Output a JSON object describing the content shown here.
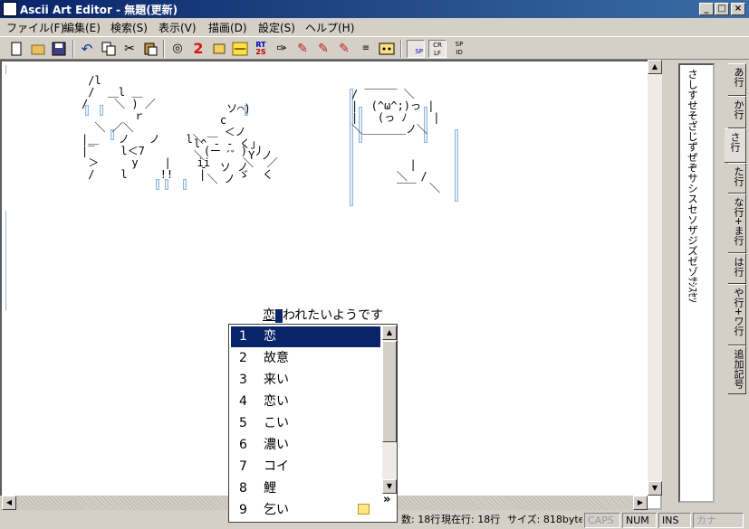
{
  "window": {
    "title": "Ascii Art Editor - 無題(更新)",
    "controls": [
      "_",
      "□",
      "×"
    ]
  },
  "menu": [
    "ファイル(F)",
    "編集(E)",
    "検索(S)",
    "表示(V)",
    "描画(D)",
    "設定(S)",
    "ヘルプ(H)"
  ],
  "toolbar": {
    "icons": [
      "new-file-icon",
      "open-folder-icon",
      "save-icon",
      "undo-icon",
      "copy-icon",
      "cut-icon",
      "paste-icon",
      "find-icon",
      "number-two-icon",
      "replace-icon",
      "line-icon",
      "rt-to-icon",
      "shape-icon",
      "dot-draw-icon",
      "trim-icon",
      "edit-icon",
      "ruler-icon",
      "face-icon",
      "space-toggle-icon",
      "crlf-toggle-icon",
      "sp-id-icon"
    ],
    "two_label": "2",
    "rts_top": "RT",
    "rts_bottom": "2S",
    "sp_label": "SP",
    "crlf_top": "CR",
    "crlf_bottom": "LF",
    "spid_top": "SP",
    "spid_bottom": "ID"
  },
  "editor": {
    "art_left": " /l\n /  ＿l ＿\n/    ＼ ) ／\n        ｒ\n  ＼ ／＼\n|＿   ノ   ノ    l＼\n|‾    l＜7         (ー   ) 丿\n ＞     y    |    ii     ＼  ／\n /    l     !!    |     ゞ  く",
    "art_left2": "     ソ⌒)\n    c\n  ＿ ＜ノ\nl^ ‐ ‐ く｣\n＼   ´゛ Y ノ\n ‐  ソ ノ\n  ＼ ノ",
    "art_bubble": "/ ‾‾‾‾‾ ＼\n|  (^ω^;)っ |\n|   (っ ﾉ    |\n＼＿＿＿＿ノ＼",
    "art_right": "  |\n＼  /\n‾‾‾  ＼"
  },
  "ime": {
    "composed_prefix": "恋",
    "composed_suffix": "われたいようです",
    "candidates": [
      {
        "num": "1",
        "word": "恋"
      },
      {
        "num": "2",
        "word": "故意"
      },
      {
        "num": "3",
        "word": "来い"
      },
      {
        "num": "4",
        "word": "恋い"
      },
      {
        "num": "5",
        "word": "こい"
      },
      {
        "num": "6",
        "word": "濃い"
      },
      {
        "num": "7",
        "word": "コイ"
      },
      {
        "num": "8",
        "word": "鯉"
      },
      {
        "num": "9",
        "word": "乞い"
      }
    ],
    "more_label": "»"
  },
  "status": {
    "lines": "数: 18行",
    "current_line": "現在行: 18行",
    "size": "サイズ: 818byte",
    "caps": "CAPS",
    "num": "NUM",
    "ins": "INS",
    "kana": "カナ"
  },
  "side": {
    "vertical_text": "さしすせそざじずぜぞサシスセソザジズゼゾｻｼｽｾｿ",
    "tabs": [
      "あ行",
      "か行",
      "さ行",
      "た行",
      "な行+ま行",
      "は行",
      "や行+ワ行",
      "追加記号"
    ],
    "active_tab": "さ行"
  }
}
